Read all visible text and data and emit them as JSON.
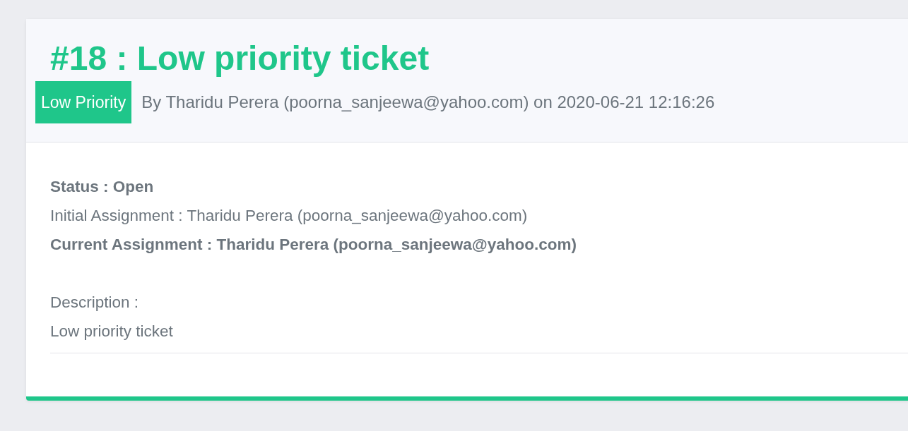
{
  "ticket": {
    "title": "#18 : Low priority ticket",
    "priority_badge": "Low Priority",
    "byline": "By Tharidu Perera (poorna_sanjeewa@yahoo.com) on 2020-06-21 12:16:26",
    "details": [
      {
        "kind": "bold",
        "text": "Status : Open"
      },
      {
        "kind": "plain",
        "text": "Initial Assignment : Tharidu Perera (poorna_sanjeewa@yahoo.com)"
      },
      {
        "kind": "bold",
        "text": "Current Assignment : Tharidu Perera (poorna_sanjeewa@yahoo.com)"
      }
    ],
    "description_label": "Description :",
    "description": "Low priority ticket"
  }
}
